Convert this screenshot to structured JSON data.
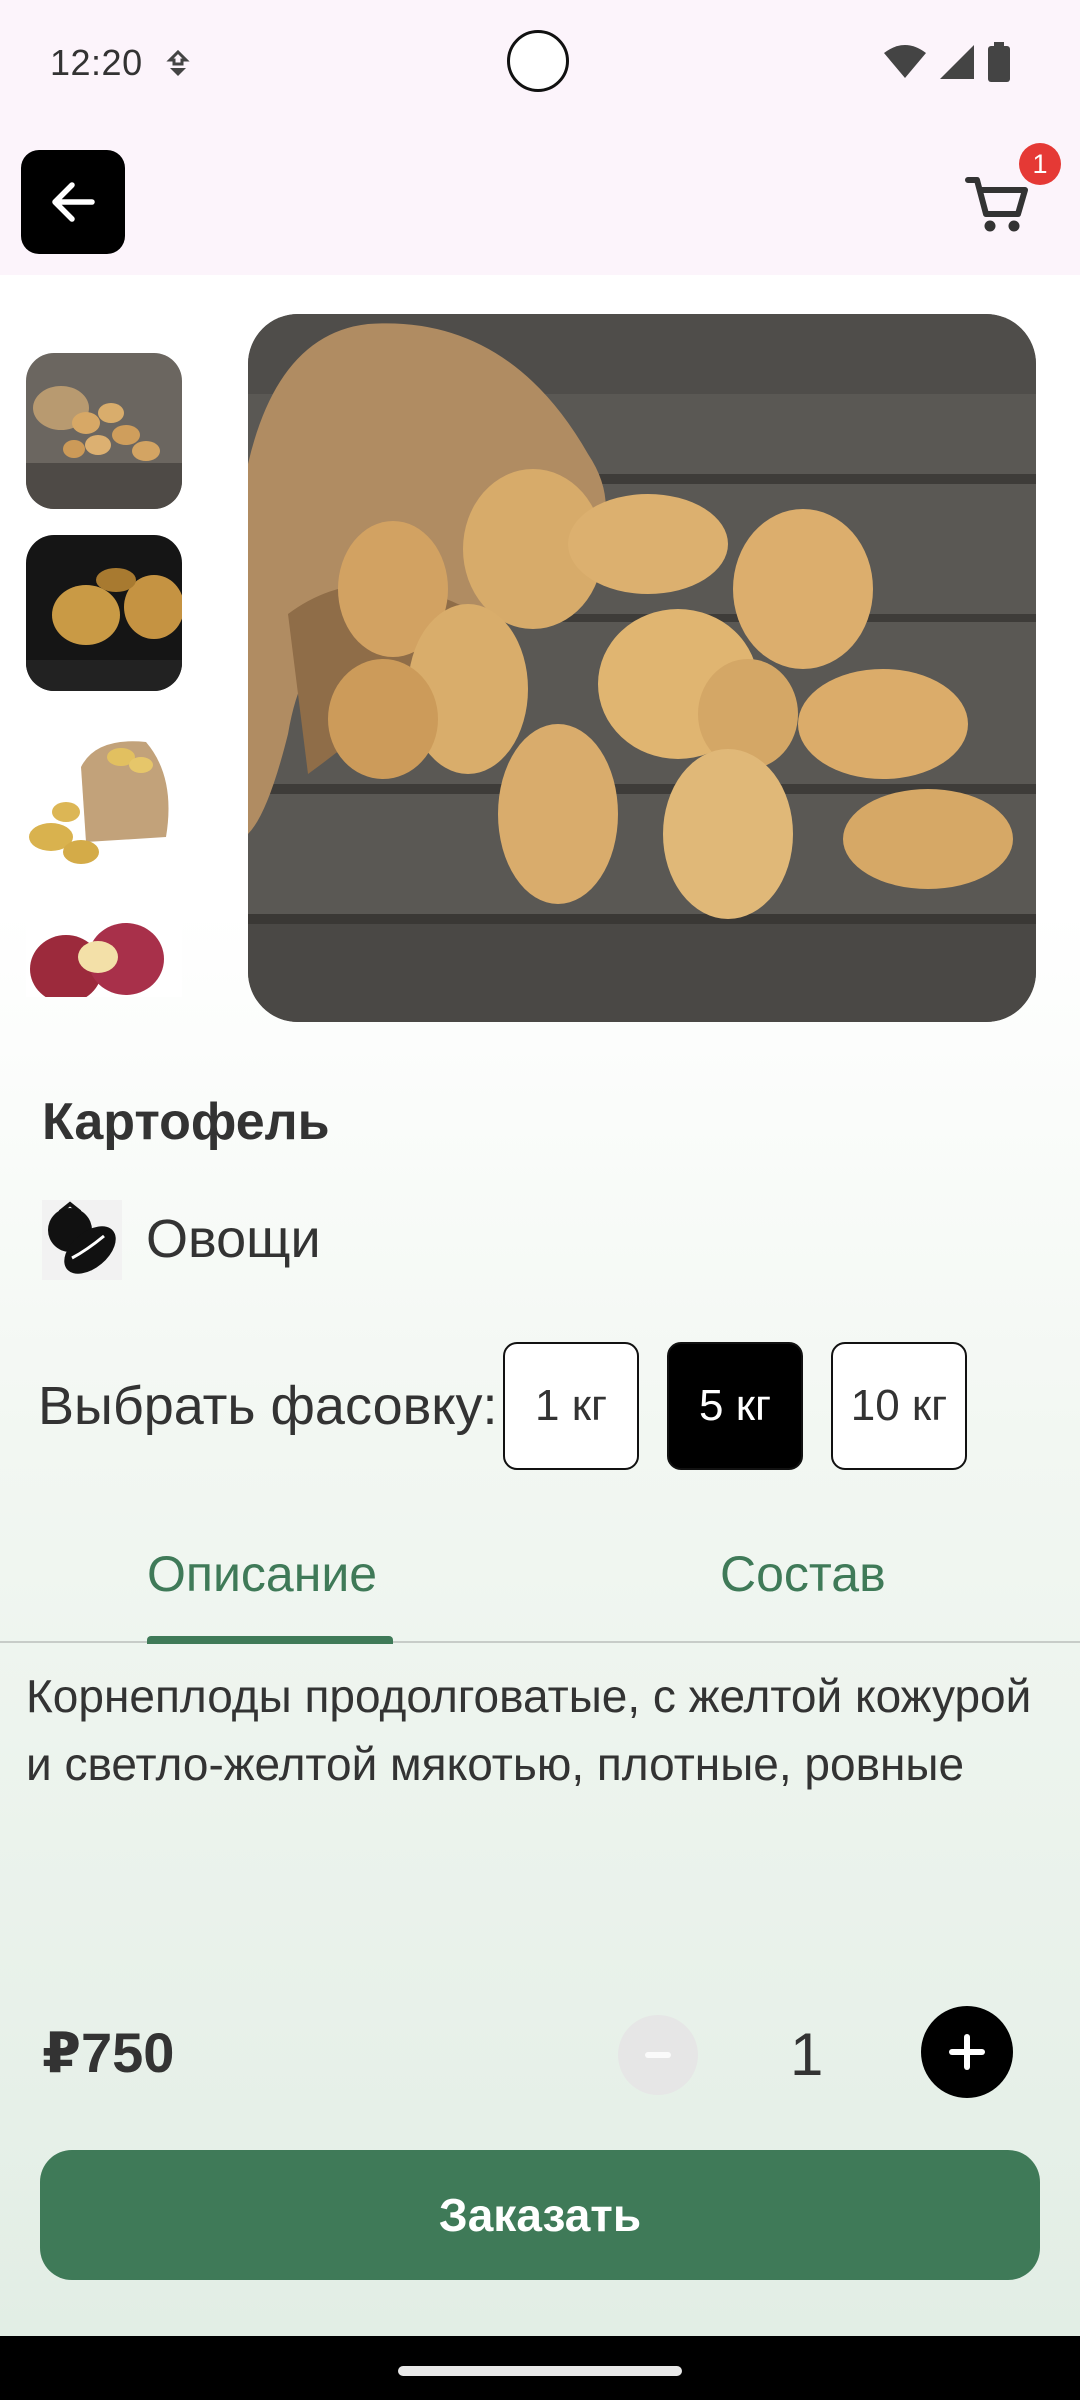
{
  "status_bar": {
    "time": "12:20"
  },
  "header": {
    "cart_count": "1"
  },
  "product": {
    "name": "Картофель",
    "category": "Овощи",
    "thumbnails": [
      "potatoes-pile",
      "potatoes-dark",
      "potatoes-sack",
      "red-potatoes"
    ]
  },
  "packaging": {
    "label": "Выбрать фасовку:",
    "options": [
      "1 кг",
      "5 кг",
      "10 кг"
    ],
    "selected": "5 кг"
  },
  "tabs": [
    {
      "label": "Описание",
      "active": true
    },
    {
      "label": "Состав",
      "active": false
    }
  ],
  "description": "Корнеплоды продолговатые, с желтой кожурой и светло-желтой мякотью, плотные, ровные",
  "purchase": {
    "price": "₽750",
    "quantity": "1",
    "order_label": "Заказать"
  },
  "colors": {
    "accent": "#3f7a58",
    "badge": "#e53935",
    "status_bar_bg": "#fcf4fb"
  }
}
